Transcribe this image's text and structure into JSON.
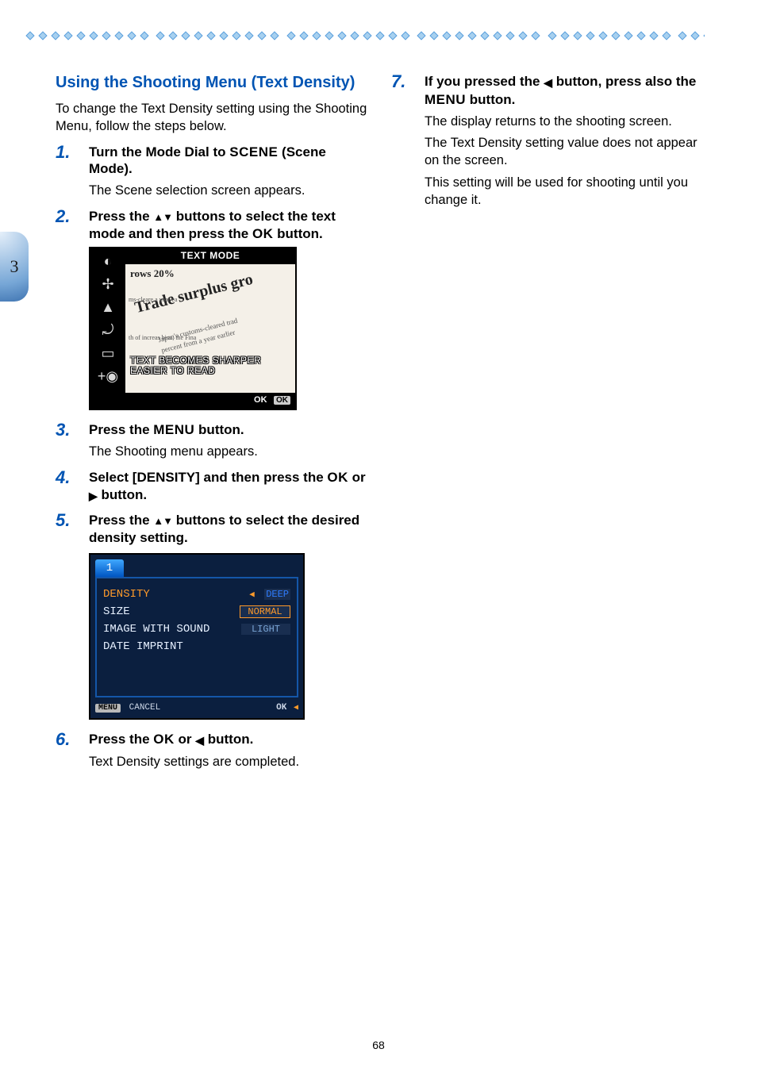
{
  "section_tab": "3",
  "page_number": "68",
  "title": "Using the Shooting Menu (Text Density)",
  "intro": "To change the Text Density setting using the Shooting Menu, follow the steps below.",
  "glyphs": {
    "scene": "SCENE",
    "menu": "MENU",
    "ok": "OK"
  },
  "steps": {
    "s1": {
      "num": "1.",
      "head_a": "Turn the Mode Dial to ",
      "head_c": " (Scene Mode).",
      "body": "The Scene selection screen appears."
    },
    "s2": {
      "num": "2.",
      "head_a": "Press the ",
      "head_c": " buttons to select the text mode and then press the ",
      "head_e": " button."
    },
    "s3": {
      "num": "3.",
      "head_a": "Press the ",
      "head_c": " button.",
      "body": "The Shooting menu appears."
    },
    "s4": {
      "num": "4.",
      "head_a": "Select  [DENSITY] and then press the ",
      "head_c": " or ",
      "head_e": " button."
    },
    "s5": {
      "num": "5.",
      "head_a": "Press the ",
      "head_c": " buttons to select the desired density setting."
    },
    "s6": {
      "num": "6.",
      "head_a": "Press the ",
      "head_c": " or ",
      "head_e": " button.",
      "body": "Text Density settings are completed."
    },
    "s7": {
      "num": "7.",
      "head_a": "If you pressed the ",
      "head_c": " button, press also the ",
      "head_e": " button.",
      "body1": "The display returns to the shooting screen.",
      "body2": "The Text Density setting value does not appear on the screen.",
      "body3": "This setting will be used for shooting until you change it."
    }
  },
  "lcd1": {
    "title": "TEXT MODE",
    "headline_top": "rows 20%",
    "headline_big": "Trade surplus gro",
    "small_a": "ms-cleare\na year ea",
    "small_b": "Japan's customs-cleared trad",
    "small_c": "percent from a year earlier",
    "small_d": "th of increas\nhina, the Fina",
    "overlay1": "TEXT BECOMES SHARPER",
    "overlay2": "EASIER TO READ",
    "ok_label": "OK",
    "ok_box": "OK",
    "icons": [
      "◐",
      "✢",
      "▲",
      "⤾",
      "▭",
      "+◉"
    ]
  },
  "lcd2": {
    "tab": "1",
    "rows": {
      "density": "DENSITY",
      "size": "SIZE",
      "image_sound": "IMAGE WITH SOUND",
      "date_imprint": "DATE IMPRINT"
    },
    "opts": {
      "deep": "DEEP",
      "normal": "NORMAL",
      "light": "LIGHT"
    },
    "footer_menu_chip": "MENU",
    "footer_cancel": "CANCEL",
    "footer_ok": "OK"
  }
}
